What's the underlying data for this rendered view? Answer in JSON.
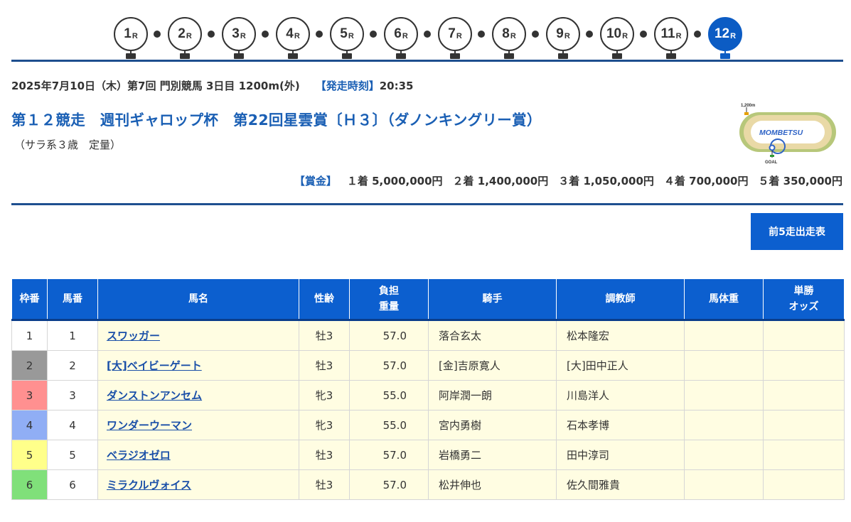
{
  "race_nav": {
    "races": [
      {
        "num": "1",
        "suffix": "R",
        "active": false
      },
      {
        "num": "2",
        "suffix": "R",
        "active": false
      },
      {
        "num": "3",
        "suffix": "R",
        "active": false
      },
      {
        "num": "4",
        "suffix": "R",
        "active": false
      },
      {
        "num": "5",
        "suffix": "R",
        "active": false
      },
      {
        "num": "6",
        "suffix": "R",
        "active": false
      },
      {
        "num": "7",
        "suffix": "R",
        "active": false
      },
      {
        "num": "8",
        "suffix": "R",
        "active": false
      },
      {
        "num": "9",
        "suffix": "R",
        "active": false
      },
      {
        "num": "10",
        "suffix": "R",
        "active": false
      },
      {
        "num": "11",
        "suffix": "R",
        "active": false
      },
      {
        "num": "12",
        "suffix": "R",
        "active": true
      }
    ]
  },
  "race_info": {
    "meta": "2025年7月10日（木）第7回 門別競馬 3日目 1200m(外)",
    "start_time_label": "【発走時刻】",
    "start_time": "20:35",
    "title": "第１２競走　週刊ギャロップ杯　第22回星雲賞〔Ｈ３〕（ダノンキングリー賞）",
    "conditions": "（サラ系３歳　定量）"
  },
  "course_map": {
    "distance_label": "1,200m",
    "track_name": "MOMBETSU",
    "goal_label": "GOAL"
  },
  "prize": {
    "label": "【賞金】",
    "items": [
      "１着 5,000,000円",
      "２着 1,400,000円",
      "３着 1,050,000円",
      "４着 700,000円",
      "５着 350,000円"
    ]
  },
  "past_button": {
    "label": "前5走出走表"
  },
  "table": {
    "headers": {
      "waku": "枠番",
      "umaban": "馬番",
      "name": "馬名",
      "sexage": "性齢",
      "weight_1": "負担",
      "weight_2": "重量",
      "jockey": "騎手",
      "trainer": "調教師",
      "body_weight": "馬体重",
      "odds_1": "単勝",
      "odds_2": "オッズ"
    },
    "rows": [
      {
        "waku": "1",
        "umaban": "1",
        "name": "スワッガー",
        "sexage": "牡3",
        "weight": "57.0",
        "jockey": "落合玄太",
        "trainer": "松本隆宏",
        "body_weight": "",
        "odds": "",
        "waku_color": "#ffffff",
        "waku_text": "#333333"
      },
      {
        "waku": "2",
        "umaban": "2",
        "name": "[大]ベイビーゲート",
        "sexage": "牡3",
        "weight": "57.0",
        "jockey": "[金]吉原寛人",
        "trainer": "[大]田中正人",
        "body_weight": "",
        "odds": "",
        "waku_color": "#999999",
        "waku_text": "#333333"
      },
      {
        "waku": "3",
        "umaban": "3",
        "name": "ダンストンアンセム",
        "sexage": "牝3",
        "weight": "55.0",
        "jockey": "阿岸潤一朗",
        "trainer": "川島洋人",
        "body_weight": "",
        "odds": "",
        "waku_color": "#ff9090",
        "waku_text": "#333333"
      },
      {
        "waku": "4",
        "umaban": "4",
        "name": "ワンダーウーマン",
        "sexage": "牝3",
        "weight": "55.0",
        "jockey": "宮内勇樹",
        "trainer": "石本孝博",
        "body_weight": "",
        "odds": "",
        "waku_color": "#90aef5",
        "waku_text": "#333333"
      },
      {
        "waku": "5",
        "umaban": "5",
        "name": "ベラジオゼロ",
        "sexage": "牡3",
        "weight": "57.0",
        "jockey": "岩橋勇二",
        "trainer": "田中淳司",
        "body_weight": "",
        "odds": "",
        "waku_color": "#ffff8a",
        "waku_text": "#333333"
      },
      {
        "waku": "6",
        "umaban": "6",
        "name": "ミラクルヴォイス",
        "sexage": "牡3",
        "weight": "57.0",
        "jockey": "松井伸也",
        "trainer": "佐久間雅貴",
        "body_weight": "",
        "odds": "",
        "waku_color": "#80e07a",
        "waku_text": "#333333"
      }
    ]
  },
  "colors": {
    "accent": "#0c5fcf",
    "active_race": "#0c5cc4",
    "title_blue": "#1a5fb4",
    "row_bg": "#fffde2"
  }
}
